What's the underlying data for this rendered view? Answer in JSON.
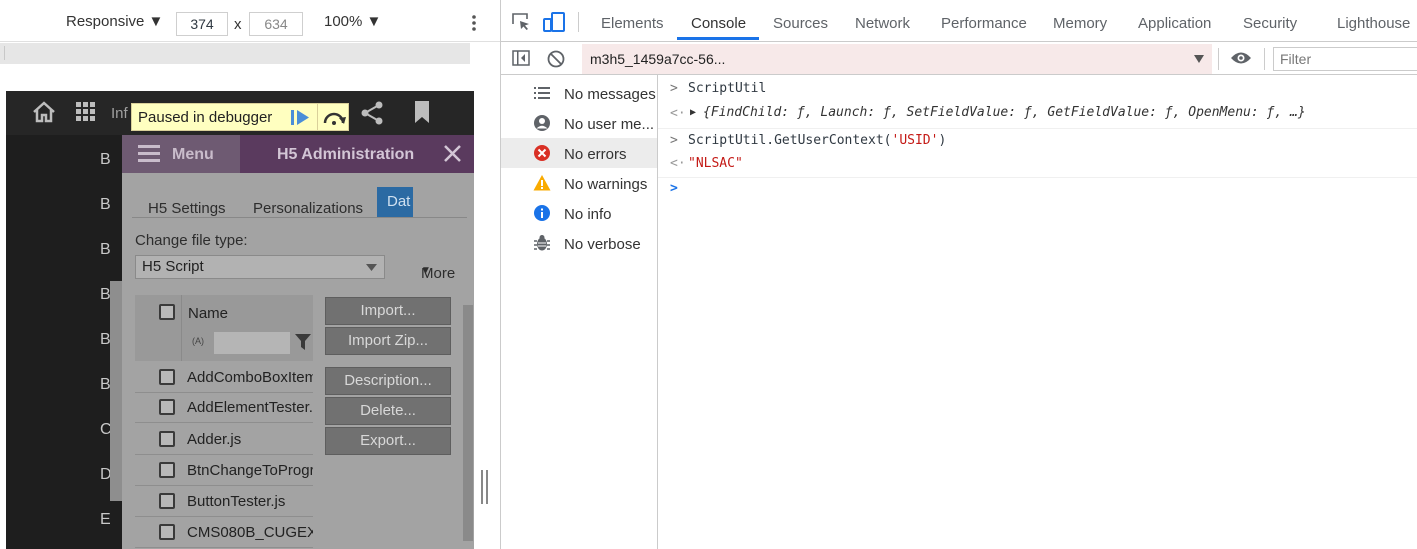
{
  "device_toolbar": {
    "device": "Responsive",
    "width": "374",
    "times": "x",
    "height": "634",
    "zoom": "100%"
  },
  "page": {
    "topbar_partial_text": "Inf",
    "sidebar_letters": [
      "B",
      "B",
      "B",
      "B",
      "B",
      "B",
      "C",
      "D",
      "E"
    ],
    "paused_banner": "Paused in debugger",
    "dialog": {
      "menu_label": "Menu",
      "title": "H5 Administration",
      "tabs": [
        "H5 Settings",
        "Personalizations",
        "Dat",
        "More"
      ],
      "file_type_label": "Change file type:",
      "file_type_value": "H5 Script",
      "column_name": "Name",
      "filter_glyph": "(A)",
      "files": [
        "AddComboBoxItem",
        "AddElementTester.",
        "Adder.js",
        "BtnChangeToProgr",
        "ButtonTester.js",
        "CMS080B_CUGEX"
      ],
      "buttons": [
        "Import...",
        "Import Zip...",
        "Description...",
        "Delete...",
        "Export..."
      ]
    }
  },
  "devtools": {
    "tabs": [
      "Elements",
      "Console",
      "Sources",
      "Network",
      "Performance",
      "Memory",
      "Application",
      "Security",
      "Lighthouse"
    ],
    "active_tab": "Console",
    "context": "m3h5_1459a7cc-56...",
    "filter_placeholder": "Filter",
    "sidebar": [
      {
        "label": "No messages",
        "icon": "list-icon"
      },
      {
        "label": "No user me...",
        "icon": "user-icon"
      },
      {
        "label": "No errors",
        "icon": "error-icon"
      },
      {
        "label": "No warnings",
        "icon": "warning-icon"
      },
      {
        "label": "No info",
        "icon": "info-icon"
      },
      {
        "label": "No verbose",
        "icon": "bug-icon"
      }
    ],
    "console": {
      "line1_input": "ScriptUtil",
      "line1_output": "{FindChild: ƒ, Launch: ƒ, SetFieldValue: ƒ, GetFieldValue: ƒ, OpenMenu: ƒ, …}",
      "line2_input_prefix": "ScriptUtil.GetUserContext(",
      "line2_input_arg": "'USID'",
      "line2_input_suffix": ")",
      "line2_output": "\"NLSAC\"",
      "prompt": ">"
    },
    "colors": {
      "accent": "#1a73e8",
      "error": "#d93025",
      "warning": "#f9ab00",
      "info": "#1a73e8",
      "string": "#c41a16",
      "dialog_header": "#5a3a5e"
    }
  }
}
